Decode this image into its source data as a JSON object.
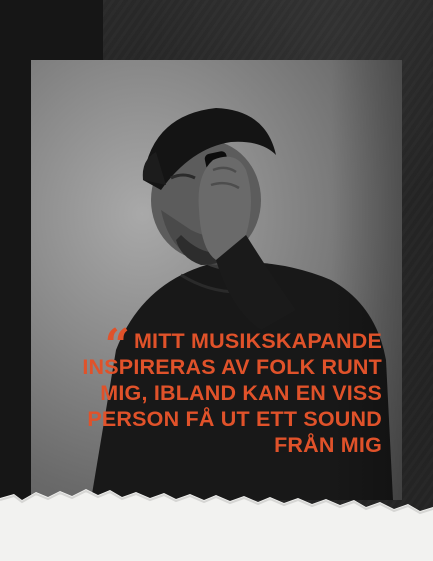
{
  "quote": {
    "mark": "“",
    "lines": [
      "MITT MUSIKSKAPANDE",
      "INSPIRERAS AV FOLK RUNT",
      "MIG, IBLAND KAN EN VISS",
      "PERSON FÅ UT ETT SOUND",
      "FRÅN MIG"
    ]
  },
  "colors": {
    "accent": "#e0522a",
    "background": "#141414",
    "paper": "#f2f2f0"
  }
}
